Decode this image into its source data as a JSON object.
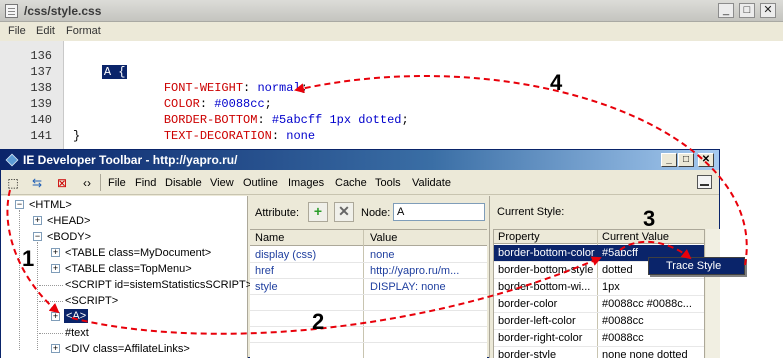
{
  "editor": {
    "title": "/css/style.css",
    "menu": [
      "File",
      "Edit",
      "Format"
    ],
    "lines": [
      {
        "num": "136",
        "selector": "A {"
      },
      {
        "num": "137",
        "prop": "FONT-WEIGHT",
        "value": "normal"
      },
      {
        "num": "138",
        "prop": "COLOR",
        "value": "#0088cc"
      },
      {
        "num": "139",
        "prop": "BORDER-BOTTOM",
        "value": "#5abcff 1px dotted"
      },
      {
        "num": "140",
        "prop": "TEXT-DECORATION",
        "value": "none"
      },
      {
        "num": "141",
        "text": "}"
      }
    ]
  },
  "toolbar_window": {
    "title": "IE Developer Toolbar - http://yapro.ru/",
    "menu": [
      "File",
      "Find",
      "Disable",
      "View",
      "Outline",
      "Images",
      "Cache",
      "Tools",
      "Validate"
    ],
    "tree": [
      {
        "label": "<HTML>"
      },
      {
        "label": "<HEAD>"
      },
      {
        "label": "<BODY>"
      },
      {
        "label": "<TABLE class=MyDocument>"
      },
      {
        "label": "<TABLE class=TopMenu>"
      },
      {
        "label": "<SCRIPT id=sistemStatisticsSCRIPT>"
      },
      {
        "label": "<SCRIPT>"
      },
      {
        "label": "<A>"
      },
      {
        "label": "#text"
      },
      {
        "label": "<DIV class=AffilateLinks>"
      }
    ],
    "attributes": {
      "label": "Attribute:",
      "node_label": "Node:",
      "node_value": "A",
      "columns": [
        "Name",
        "Value"
      ],
      "rows": [
        {
          "name": "display (css)",
          "value": "none"
        },
        {
          "name": "href",
          "value": "http://yapro.ru/m..."
        },
        {
          "name": "style",
          "value": "DISPLAY: none"
        }
      ]
    },
    "current_style": {
      "label": "Current Style:",
      "columns": [
        "Property",
        "Current Value"
      ],
      "rows": [
        {
          "prop": "border-bottom-color",
          "value": "#5abcff"
        },
        {
          "prop": "border-bottom-style",
          "value": "dotted"
        },
        {
          "prop": "border-bottom-wi...",
          "value": "1px"
        },
        {
          "prop": "border-color",
          "value": "#0088cc #0088c..."
        },
        {
          "prop": "border-left-color",
          "value": "#0088cc"
        },
        {
          "prop": "border-right-color",
          "value": "#0088cc"
        },
        {
          "prop": "border-style",
          "value": "none none dotted"
        }
      ],
      "context_menu": "Trace Style"
    }
  },
  "annotations": [
    "1",
    "2",
    "3",
    "4"
  ],
  "colors": {
    "arrow": "#e8000a",
    "selection": "#0a246a",
    "property": "#cc0000",
    "value": "#0000cc"
  }
}
